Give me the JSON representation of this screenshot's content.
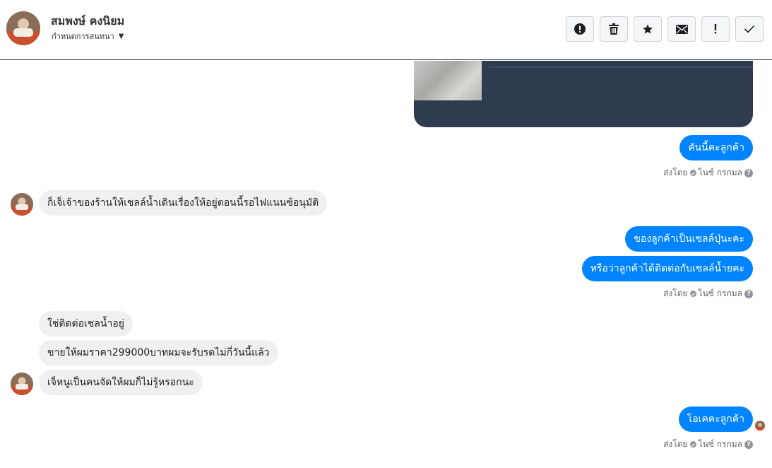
{
  "header": {
    "name": "สมพงษ์ คงนิยม",
    "subtitle": "กำหนดการสนทนา",
    "actions": [
      {
        "icon": "alert-circle-icon",
        "name": "report-button"
      },
      {
        "icon": "trash-icon",
        "name": "delete-button"
      },
      {
        "icon": "star-icon",
        "name": "star-button"
      },
      {
        "icon": "envelope-icon",
        "name": "mark-unread-button"
      },
      {
        "icon": "exclamation-icon",
        "name": "spam-button"
      },
      {
        "icon": "checkmark-icon",
        "name": "done-button"
      }
    ]
  },
  "messages": {
    "m1": "คันนี้คะลูกค้า",
    "m2": "ก็เจ็เจ้าของร้านให้เชลล์น้ำเดินเรื่องให้อยู่ตอนนี้รอไฟแนนซ้อนุมัติ",
    "m3": "ของลูกค้าเป็นเซลล์ปุ่นะคะ",
    "m4": "หรือว่าลูกค้าได้ติดต่อกับเซลล์น้ำยคะ",
    "m5": "ใช่ติดต่อเชลน้ำอยู่",
    "m6": "ขายให้ผมราคา299000บาทผมจะรับรดไม่กี่วันนี้แล้ว",
    "m7": "เจ็หนูเป็นคนจัดให้ผมก็ไม่รู้หรอกนะ",
    "m8": "โอเคคะลูกค้า"
  },
  "meta": {
    "sent_by": "ส่งโดย",
    "sender": "ไนซ์ กรกมล",
    "help": "?"
  },
  "colors": {
    "outgoing": "#0084ff",
    "incoming": "#f1f0f0",
    "media_bg": "#2f3b4f"
  }
}
